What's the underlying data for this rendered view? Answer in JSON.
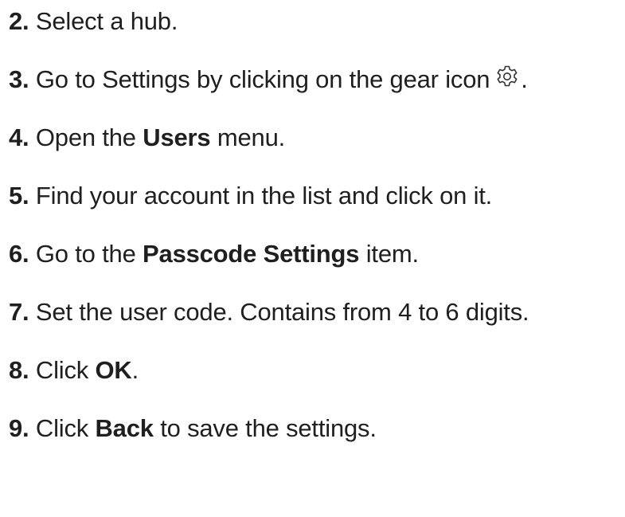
{
  "steps": [
    {
      "num": "2.",
      "text": "Select a hub."
    },
    {
      "num": "3.",
      "text_before": "Go to Settings by clicking on the gear icon",
      "text_after": ".",
      "icon": "gear-icon"
    },
    {
      "num": "4.",
      "text_before": "Open the",
      "bold": "Users",
      "text_after": "menu."
    },
    {
      "num": "5.",
      "text": "Find your account in the list and click on it."
    },
    {
      "num": "6.",
      "text_before": "Go to the",
      "bold": "Passcode Settings",
      "text_after": "item."
    },
    {
      "num": "7.",
      "text": "Set the user code. Contains from 4 to 6 digits."
    },
    {
      "num": "8.",
      "text_before": "Click",
      "bold": "OK",
      "text_after": "."
    },
    {
      "num": "9.",
      "text_before": "Click",
      "bold": "Back",
      "text_after": "to save the settings."
    }
  ]
}
